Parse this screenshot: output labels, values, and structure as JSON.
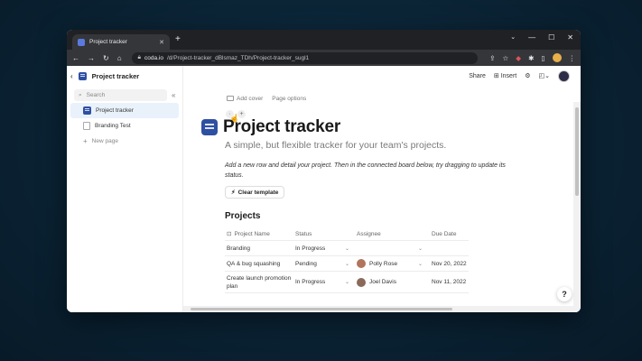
{
  "browser": {
    "tab_title": "Project tracker",
    "url_host": "coda.io",
    "url_path": "/d/Project-tracker_dBlsmaz_TDh/Project-tracker_sugl1"
  },
  "sidebar": {
    "doc_title": "Project tracker",
    "search_placeholder": "Search",
    "items": [
      {
        "label": "Project tracker"
      },
      {
        "label": "Branding Test"
      }
    ],
    "new_page_label": "New page"
  },
  "topbar": {
    "share_label": "Share",
    "insert_label": "Insert"
  },
  "doc": {
    "add_cover_label": "Add cover",
    "page_options_label": "Page options",
    "title": "Project tracker",
    "subtitle": "A simple, but flexible tracker for your team's projects.",
    "description": "Add a new row and detail your project. Then in the connected board below, try dragging to update its status.",
    "clear_template_label": "Clear template",
    "section_heading": "Projects"
  },
  "table": {
    "columns": [
      "Project Name",
      "Status",
      "Assignee",
      "Due Date"
    ],
    "rows": [
      {
        "name": "Branding",
        "status": "In Progress",
        "assignee": "",
        "due": ""
      },
      {
        "name": "QA & bug squashing",
        "status": "Pending",
        "assignee": "Polly Rose",
        "due": "Nov 20, 2022"
      },
      {
        "name": "Create launch promotion plan",
        "status": "In Progress",
        "assignee": "Joel Davis",
        "due": "Nov 11, 2022"
      }
    ]
  },
  "help_label": "?",
  "icons": [
    "back-icon",
    "forward-icon",
    "reload-icon",
    "home-icon",
    "lock-icon",
    "search-icon",
    "collapse-icon",
    "gear-icon",
    "bookmark-icon",
    "bolt-icon"
  ]
}
